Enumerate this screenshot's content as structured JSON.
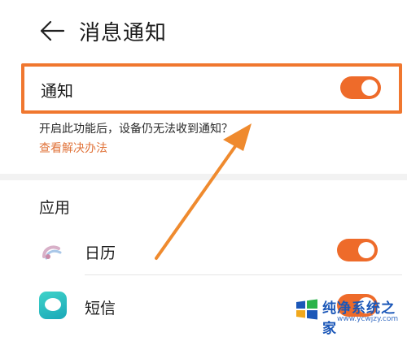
{
  "header": {
    "title": "消息通知",
    "back_icon": "arrow-left-icon"
  },
  "notification": {
    "label": "通知",
    "enabled": true,
    "help_text": "开启此功能后，设备仍无法收到通知？",
    "help_link": "查看解决办法"
  },
  "apps_section": {
    "title": "应用",
    "items": [
      {
        "name": "日历",
        "icon": "calendar-app-icon",
        "enabled": true
      },
      {
        "name": "短信",
        "icon": "messages-app-icon",
        "enabled": true
      }
    ]
  },
  "watermark": {
    "title": "纯净系统之家",
    "url": "www.ycwjzy.com"
  },
  "colors": {
    "accent": "#ee6b2a",
    "highlight_border": "#f0772f",
    "link": "#e0733a",
    "annotation_arrow": "#ef8a2e",
    "watermark_blue": "#1b57b8"
  }
}
